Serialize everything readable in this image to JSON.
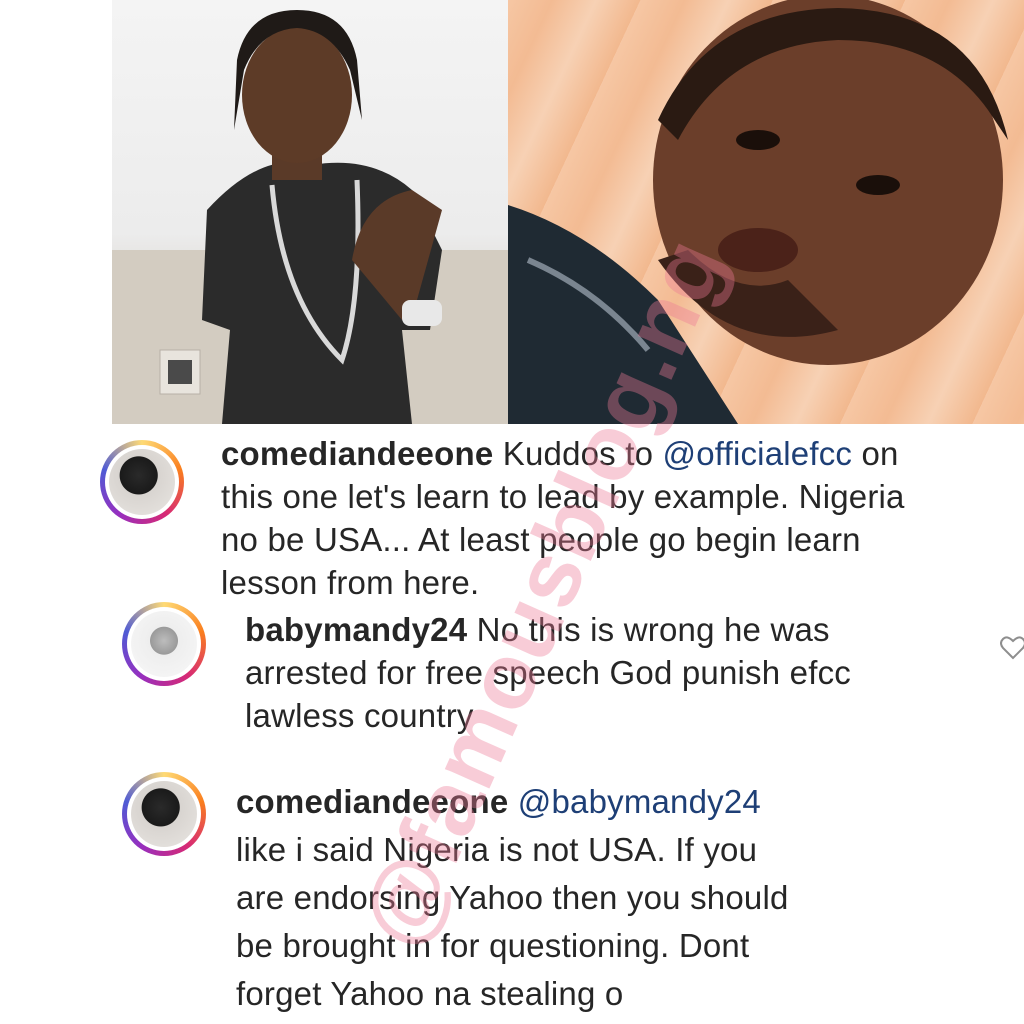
{
  "comments": [
    {
      "username": "comediandeeone",
      "body_prefix": " Kuddos to ",
      "mention": "@officialefcc",
      "body_suffix": " on",
      "lines": [
        "this one let's learn to lead by example. Nigeria",
        "no be USA... At least people go begin learn",
        "lesson from here."
      ]
    },
    {
      "username": "babymandy24",
      "body_first": " No this is wrong he was",
      "lines": [
        "arrested for free speech God punish efcc",
        "lawless country"
      ]
    },
    {
      "username": "comediandeeone",
      "mention": " @babymandy24",
      "lines": [
        "like i said Nigeria is not USA. If you",
        "are endorsing Yahoo then you should",
        "be brought in for questioning. Dont",
        "forget Yahoo na stealing o"
      ]
    }
  ],
  "watermark": "@famousblog.ng",
  "colors": {
    "mention": "#1e3f76",
    "text": "#262626",
    "watermark": "#ec7896"
  },
  "icons": [
    "heart-icon",
    "avatar",
    "photo"
  ]
}
